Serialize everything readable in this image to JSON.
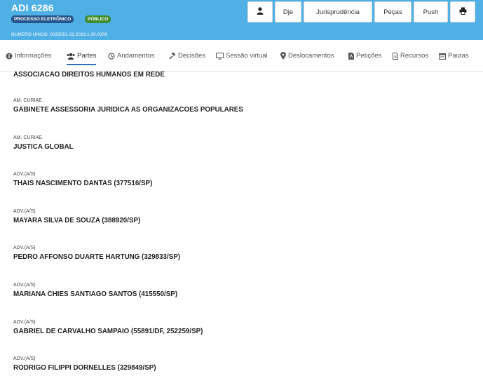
{
  "header": {
    "title": "ADI 6286",
    "badge_eletronico": "PROCESSO ELETRÔNICO",
    "badge_publico": "PÚBLICO",
    "numero_unico": "NÚMERO ÚNICO: 0035051-22.2019.1.00.0000",
    "buttons": {
      "user_icon": "user-icon",
      "dje": "Dje",
      "jurisprudencia": "Jurisprudência",
      "pecas": "Peças",
      "push": "Push",
      "print_icon": "print-icon"
    }
  },
  "tabs": [
    {
      "label": "Informações",
      "icon": "info-icon"
    },
    {
      "label": "Partes",
      "icon": "users-icon",
      "active": true
    },
    {
      "label": "Andamentos",
      "icon": "history-icon"
    },
    {
      "label": "Decisões",
      "icon": "gavel-icon"
    },
    {
      "label": "Sessão virtual",
      "icon": "monitor-icon"
    },
    {
      "label": "Deslocamentos",
      "icon": "map-marker-icon"
    },
    {
      "label": "Petições",
      "icon": "file-pdf-icon"
    },
    {
      "label": "Recursos",
      "icon": "file-icon"
    },
    {
      "label": "Pautas",
      "icon": "calendar-icon"
    }
  ],
  "partes": [
    {
      "role": "",
      "name": "ASSOCIACAO DIREITOS HUMANOS EM REDE"
    },
    {
      "role": "AM. CURIAE.",
      "name": "GABINETE ASSESSORIA JURIDICA AS ORGANIZACOES POPULARES"
    },
    {
      "role": "AM. CURIAE.",
      "name": "JUSTICA GLOBAL"
    },
    {
      "role": "ADV.(A/S)",
      "name": "THAIS NASCIMENTO DANTAS (377516/SP)"
    },
    {
      "role": "ADV.(A/S)",
      "name": "MAYARA SILVA DE SOUZA (388920/SP)"
    },
    {
      "role": "ADV.(A/S)",
      "name": "PEDRO AFFONSO DUARTE HARTUNG (329833/SP)"
    },
    {
      "role": "ADV.(A/S)",
      "name": "MARIANA CHIES SANTIAGO SANTOS (415550/SP)"
    },
    {
      "role": "ADV.(A/S)",
      "name": "GABRIEL DE CARVALHO SAMPAIO (55891/DF, 252259/SP)"
    },
    {
      "role": "ADV.(A/S)",
      "name": "RODRIGO FILIPPI DORNELLES (329849/SP)"
    }
  ]
}
